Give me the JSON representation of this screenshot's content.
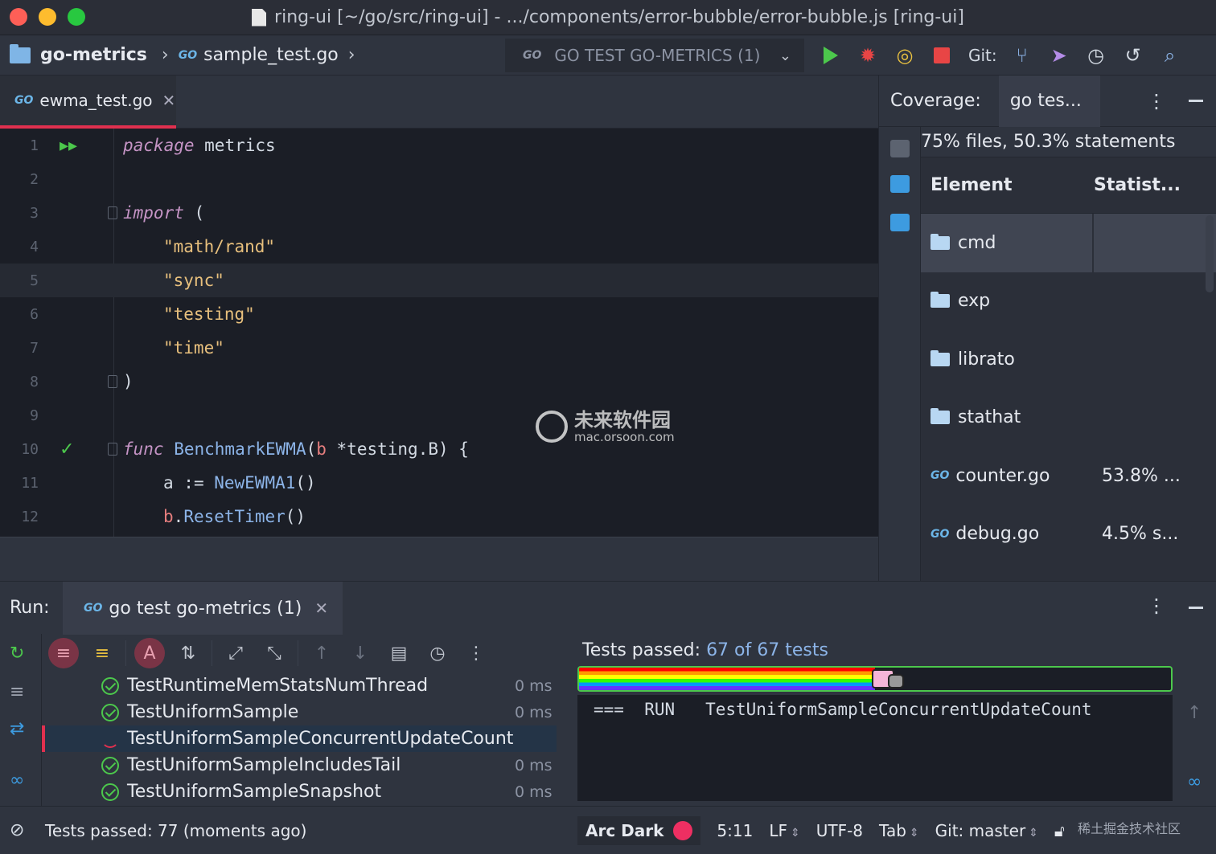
{
  "window": {
    "title": "ring-ui [~/go/src/ring-ui] - .../components/error-bubble/error-bubble.js [ring-ui]"
  },
  "navbar": {
    "project": "go-metrics",
    "file": "sample_test.go",
    "run_config": "GO TEST GO-METRICS (1)",
    "git_label": "Git:",
    "go_badge": "GO"
  },
  "editor": {
    "tab_label": "ewma_test.go",
    "lines": [
      {
        "n": "1"
      },
      {
        "n": "2"
      },
      {
        "n": "3"
      },
      {
        "n": "4"
      },
      {
        "n": "5"
      },
      {
        "n": "6"
      },
      {
        "n": "7"
      },
      {
        "n": "8"
      },
      {
        "n": "9"
      },
      {
        "n": "10"
      },
      {
        "n": "11"
      },
      {
        "n": "12"
      }
    ],
    "code": {
      "l1_kw": "package",
      "l1_rest": " metrics",
      "l3_kw": "import",
      "l3_rest": " (",
      "l4": "\"math/rand\"",
      "l5": "\"sync\"",
      "l6": "\"testing\"",
      "l7": "\"time\"",
      "l8": ")",
      "l10_kw": "func",
      "l10_fn": " BenchmarkEWMA",
      "l10_open": "(",
      "l10_param": "b",
      "l10_rest": " *testing.B) {",
      "l11_var": "a",
      "l11_op": " := ",
      "l11_fn": "NewEWMA1",
      "l11_rest": "()",
      "l12_var": "b",
      "l12_dot": ".",
      "l12_fn": "ResetTimer",
      "l12_rest": "()"
    }
  },
  "watermark": {
    "line1": "未来软件园",
    "line2": "mac.orsoon.com"
  },
  "coverage": {
    "label": "Coverage:",
    "tab": "go tes...",
    "summary": "75% files, 50.3% statements",
    "headers": [
      "Element",
      "Statist..."
    ],
    "rows": [
      {
        "name": "cmd",
        "kind": "folder",
        "stat": ""
      },
      {
        "name": "exp",
        "kind": "folder",
        "stat": ""
      },
      {
        "name": "librato",
        "kind": "folder",
        "stat": ""
      },
      {
        "name": "stathat",
        "kind": "folder",
        "stat": ""
      },
      {
        "name": "counter.go",
        "kind": "go-file",
        "stat": "53.8% ..."
      },
      {
        "name": "debug.go",
        "kind": "go-file",
        "stat": "4.5% s..."
      }
    ]
  },
  "run": {
    "label": "Run:",
    "tab": "go test go-metrics (1)",
    "passed_prefix": "Tests passed: ",
    "passed_count": "67",
    "passed_mid": " of ",
    "passed_total": "67 tests",
    "progress": 0.5,
    "output": "===  RUN   TestUniformSampleConcurrentUpdateCount",
    "tests": [
      {
        "name": "TestRuntimeMemStatsNumThread",
        "duration": "0 ms",
        "status": "passed"
      },
      {
        "name": "TestUniformSample",
        "duration": "0 ms",
        "status": "passed"
      },
      {
        "name": "TestUniformSampleConcurrentUpdateCount",
        "duration": "",
        "status": "running"
      },
      {
        "name": "TestUniformSampleIncludesTail",
        "duration": "0 ms",
        "status": "passed"
      },
      {
        "name": "TestUniformSampleSnapshot",
        "duration": "0 ms",
        "status": "passed"
      }
    ]
  },
  "statusbar": {
    "message": "Tests passed: 77 (moments ago)",
    "theme": "Arc Dark",
    "position": "5:11",
    "line_sep": "LF",
    "encoding": "UTF-8",
    "indent": "Tab",
    "branch": "Git: master",
    "watermark_tail": "稀土掘金技术社区"
  },
  "colors": {
    "accent": "#e0304f",
    "success": "#4cc84c",
    "keyword": "#c594c5",
    "string": "#e8c07d",
    "function": "#8cb4e8"
  }
}
